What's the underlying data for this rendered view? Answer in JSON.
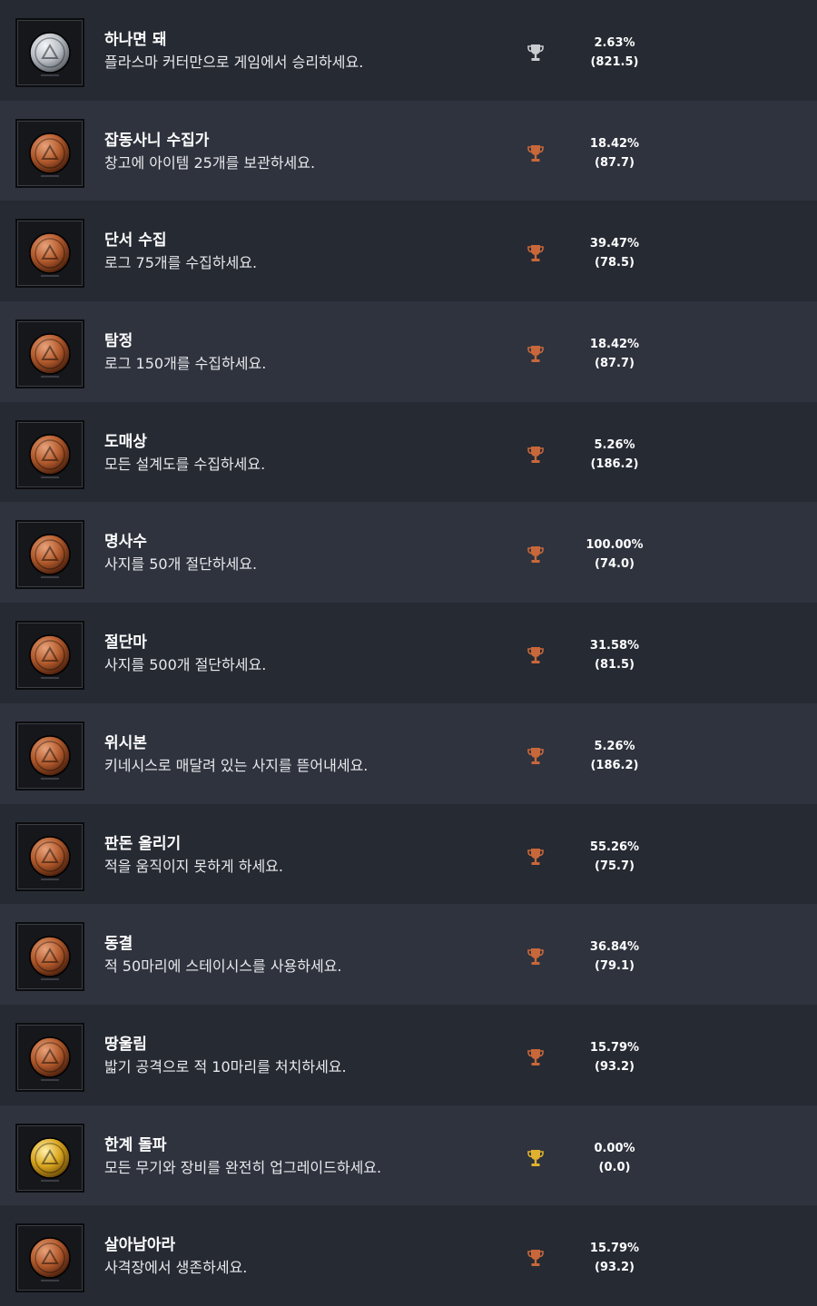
{
  "colors": {
    "row_dark": "#262a33",
    "row_light": "#2f333e",
    "silver": "#c9ccd1",
    "bronze": "#c8683a",
    "gold": "#e0b12e"
  },
  "achievements": [
    {
      "title": "하나면 돼",
      "description": "플라스마 커터만으로 게임에서 승리하세요.",
      "percent": "2.63%",
      "points": "(821.5)",
      "tier": "silver",
      "icon": "silver-medal-icon"
    },
    {
      "title": "잡동사니 수집가",
      "description": "창고에 아이템 25개를 보관하세요.",
      "percent": "18.42%",
      "points": "(87.7)",
      "tier": "bronze",
      "icon": "bronze-medal-icon"
    },
    {
      "title": "단서 수집",
      "description": "로그 75개를 수집하세요.",
      "percent": "39.47%",
      "points": "(78.5)",
      "tier": "bronze",
      "icon": "bronze-medal-icon"
    },
    {
      "title": "탐정",
      "description": "로그 150개를 수집하세요.",
      "percent": "18.42%",
      "points": "(87.7)",
      "tier": "bronze",
      "icon": "bronze-medal-icon"
    },
    {
      "title": "도매상",
      "description": "모든 설계도를 수집하세요.",
      "percent": "5.26%",
      "points": "(186.2)",
      "tier": "bronze",
      "icon": "bronze-medal-icon"
    },
    {
      "title": "명사수",
      "description": "사지를 50개 절단하세요.",
      "percent": "100.00%",
      "points": "(74.0)",
      "tier": "bronze",
      "icon": "bronze-medal-icon"
    },
    {
      "title": "절단마",
      "description": "사지를 500개 절단하세요.",
      "percent": "31.58%",
      "points": "(81.5)",
      "tier": "bronze",
      "icon": "bronze-medal-icon"
    },
    {
      "title": "위시본",
      "description": "키네시스로 매달려 있는 사지를 뜯어내세요.",
      "percent": "5.26%",
      "points": "(186.2)",
      "tier": "bronze",
      "icon": "bronze-medal-icon"
    },
    {
      "title": "판돈 올리기",
      "description": "적을 움직이지 못하게 하세요.",
      "percent": "55.26%",
      "points": "(75.7)",
      "tier": "bronze",
      "icon": "bronze-medal-icon"
    },
    {
      "title": "동결",
      "description": "적 50마리에 스테이시스를 사용하세요.",
      "percent": "36.84%",
      "points": "(79.1)",
      "tier": "bronze",
      "icon": "bronze-medal-icon"
    },
    {
      "title": "땅울림",
      "description": "밟기 공격으로 적 10마리를 처치하세요.",
      "percent": "15.79%",
      "points": "(93.2)",
      "tier": "bronze",
      "icon": "bronze-medal-icon"
    },
    {
      "title": "한계 돌파",
      "description": "모든 무기와 장비를 완전히 업그레이드하세요.",
      "percent": "0.00%",
      "points": "(0.0)",
      "tier": "gold",
      "icon": "gold-medal-icon"
    },
    {
      "title": "살아남아라",
      "description": "사격장에서 생존하세요.",
      "percent": "15.79%",
      "points": "(93.2)",
      "tier": "bronze",
      "icon": "bronze-medal-icon"
    }
  ]
}
